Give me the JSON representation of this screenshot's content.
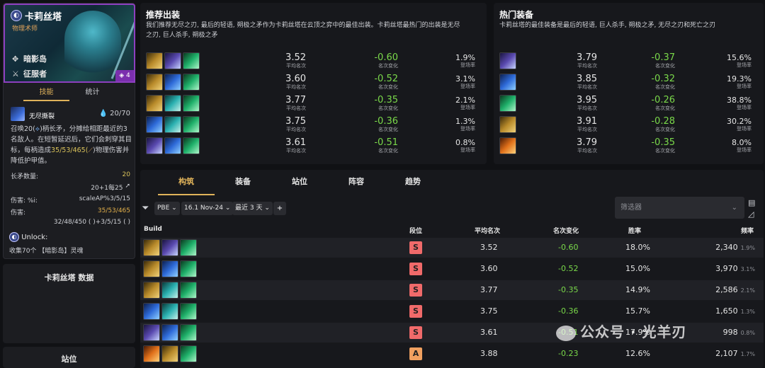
{
  "champion": {
    "name": "卡莉丝塔",
    "role": "物理术师",
    "traits": [
      "暗影岛",
      "征服者"
    ],
    "cost": "4",
    "tabs": [
      "技能",
      "统计"
    ],
    "ability_name": "无尽撕裂",
    "mana": "20/70",
    "desc": "召唤20(",
    "desc_mid": ")柄长矛，分摊给相距最近的3名敌人。在短暂延迟后，它们会刺穿其目标，每柄造成",
    "desc_hl": "35/53/465(",
    "desc_end": ")物理伤害并降低护甲值。",
    "stats": [
      {
        "label": "长矛数量:",
        "value": "20"
      },
      {
        "label": "",
        "value": "20+1每25"
      },
      {
        "label": "伤害: %i:",
        "value": "scaleAP%3/5/15"
      },
      {
        "label": "伤害:",
        "value": "35/53/465"
      },
      {
        "label": "",
        "value": "32/48/450 (   )+3/5/15 (   )"
      }
    ],
    "unlock_label": "Unlock:",
    "unlock_text": "收集70个 【暗影岛】灵魂"
  },
  "data_card_title": "卡莉丝塔 数据",
  "pos_card_title": "站位",
  "recommended": {
    "title": "推荐出装",
    "desc_line1": "我们推荐无尽之刃, 最后的轻语, 朔极之矛作为卡莉丝塔在云顶之弈中的最佳出装。卡莉丝塔最热门的出装是无尽",
    "desc_line2": "之刃, 巨人杀手, 朔极之矛",
    "avg_label": "平均名次",
    "chg_label": "名次变化",
    "rate_label": "登场率",
    "rows": [
      {
        "icons": [
          "i-gold",
          "i-purple",
          "i-green"
        ],
        "avg": "3.52",
        "chg": "-0.60",
        "rate": "1.9%"
      },
      {
        "icons": [
          "i-gold",
          "i-blue",
          "i-green"
        ],
        "avg": "3.60",
        "chg": "-0.52",
        "rate": "3.1%"
      },
      {
        "icons": [
          "i-gold",
          "i-teal",
          "i-green"
        ],
        "avg": "3.77",
        "chg": "-0.35",
        "rate": "2.1%"
      },
      {
        "icons": [
          "i-blue",
          "i-teal",
          "i-green"
        ],
        "avg": "3.75",
        "chg": "-0.36",
        "rate": "1.3%"
      },
      {
        "icons": [
          "i-purple",
          "i-blue",
          "i-green"
        ],
        "avg": "3.61",
        "chg": "-0.51",
        "rate": "0.8%"
      }
    ]
  },
  "hot": {
    "title": "热门装备",
    "desc": "卡莉丝塔的最佳装备是最后的轻语, 巨人杀手, 朔极之矛, 无尽之刃和死亡之刃",
    "rows": [
      {
        "icon": "i-purple",
        "avg": "3.79",
        "chg": "-0.37",
        "rate": "15.6%"
      },
      {
        "icon": "i-blue",
        "avg": "3.85",
        "chg": "-0.32",
        "rate": "19.3%"
      },
      {
        "icon": "i-green",
        "avg": "3.95",
        "chg": "-0.26",
        "rate": "38.8%"
      },
      {
        "icon": "i-gold",
        "avg": "3.91",
        "chg": "-0.28",
        "rate": "30.2%"
      },
      {
        "icon": "i-fire",
        "avg": "3.79",
        "chg": "-0.35",
        "rate": "8.0%"
      }
    ]
  },
  "table": {
    "tabs": [
      "构筑",
      "装备",
      "站位",
      "阵容",
      "趋势"
    ],
    "filters": {
      "set": "PBE",
      "patch": "16.1 Nov-24",
      "range": "最近 3 天"
    },
    "selector_placeholder": "筛选器",
    "headers": {
      "build": "Build",
      "tier": "段位",
      "avg": "平均名次",
      "chg": "名次变化",
      "win": "胜率",
      "freq": "频率"
    },
    "rows": [
      {
        "icons": [
          "i-gold",
          "i-purple",
          "i-green"
        ],
        "tier": "S",
        "avg": "3.52",
        "chg": "-0.60",
        "win": "18.0%",
        "freq": "2,340",
        "freq_pct": "1.9%"
      },
      {
        "icons": [
          "i-gold",
          "i-blue",
          "i-green"
        ],
        "tier": "S",
        "avg": "3.60",
        "chg": "-0.52",
        "win": "15.0%",
        "freq": "3,970",
        "freq_pct": "3.1%"
      },
      {
        "icons": [
          "i-gold",
          "i-teal",
          "i-green"
        ],
        "tier": "S",
        "avg": "3.77",
        "chg": "-0.35",
        "win": "14.9%",
        "freq": "2,586",
        "freq_pct": "2.1%"
      },
      {
        "icons": [
          "i-blue",
          "i-teal",
          "i-green"
        ],
        "tier": "S",
        "avg": "3.75",
        "chg": "-0.36",
        "win": "15.7%",
        "freq": "1,650",
        "freq_pct": "1.3%"
      },
      {
        "icons": [
          "i-purple",
          "i-blue",
          "i-green"
        ],
        "tier": "S",
        "avg": "3.61",
        "chg": "-0.51",
        "win": "17.9%",
        "freq": "998",
        "freq_pct": "0.8%"
      },
      {
        "icons": [
          "i-fire",
          "i-gold",
          "i-green"
        ],
        "tier": "A",
        "avg": "3.88",
        "chg": "-0.23",
        "win": "12.6%",
        "freq": "2,107",
        "freq_pct": "1.7%"
      }
    ]
  },
  "watermark": "公众号 · 光羊刃"
}
